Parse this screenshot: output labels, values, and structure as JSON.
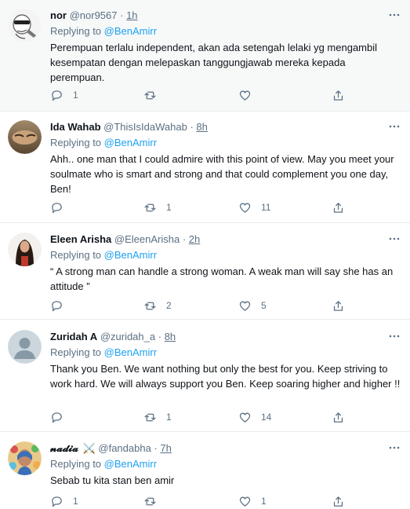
{
  "reply_prefix": "Replying to",
  "tweets": [
    {
      "name": "nor",
      "handle": "@nor9567",
      "dot": "·",
      "time": "1h",
      "reply_to": "@BenAmirr",
      "text": "Perempuan terlalu independent, akan ada setengah lelaki yg mengambil kesempatan dengan melepaskan tanggungjawab mereka kepada perempuan.",
      "replies": "1",
      "retweets": "",
      "likes": "",
      "avatar": "cartoon-avatar"
    },
    {
      "name": "Ida Wahab",
      "handle": "@ThisIsIdaWahab",
      "dot": "·",
      "time": "8h",
      "reply_to": "@BenAmirr",
      "text": "Ahh.. one man that I could admire with this point of view. May you meet your soulmate who is smart and strong and that could complement you one day, Ben!",
      "replies": "",
      "retweets": "1",
      "likes": "11",
      "avatar": "photo-avatar"
    },
    {
      "name": "Eleen Arisha",
      "handle": "@EleenArisha",
      "dot": "·",
      "time": "2h",
      "reply_to": "@BenAmirr",
      "text": "“ A strong man can handle a strong woman. A weak man will say she has an attitude ”",
      "replies": "",
      "retweets": "2",
      "likes": "5",
      "avatar": "photo-avatar"
    },
    {
      "name": "Zuridah A",
      "handle": "@zuridah_a",
      "dot": "·",
      "time": "8h",
      "reply_to": "@BenAmirr",
      "text": "Thank you Ben. We want nothing but only the best for you. Keep striving to work hard. We will always support you Ben. Keep soaring higher and higher !!",
      "replies": "",
      "retweets": "1",
      "likes": "14",
      "avatar": "default-avatar"
    },
    {
      "name": "𝓷𝓪𝓭𝓲𝓪",
      "name_emoji": "⚔️",
      "handle": "@fandabha",
      "dot": "·",
      "time": "7h",
      "reply_to": "@BenAmirr",
      "text": "Sebab tu kita stan ben amir",
      "replies": "1",
      "retweets": "",
      "likes": "1",
      "avatar": "photo-avatar"
    }
  ]
}
